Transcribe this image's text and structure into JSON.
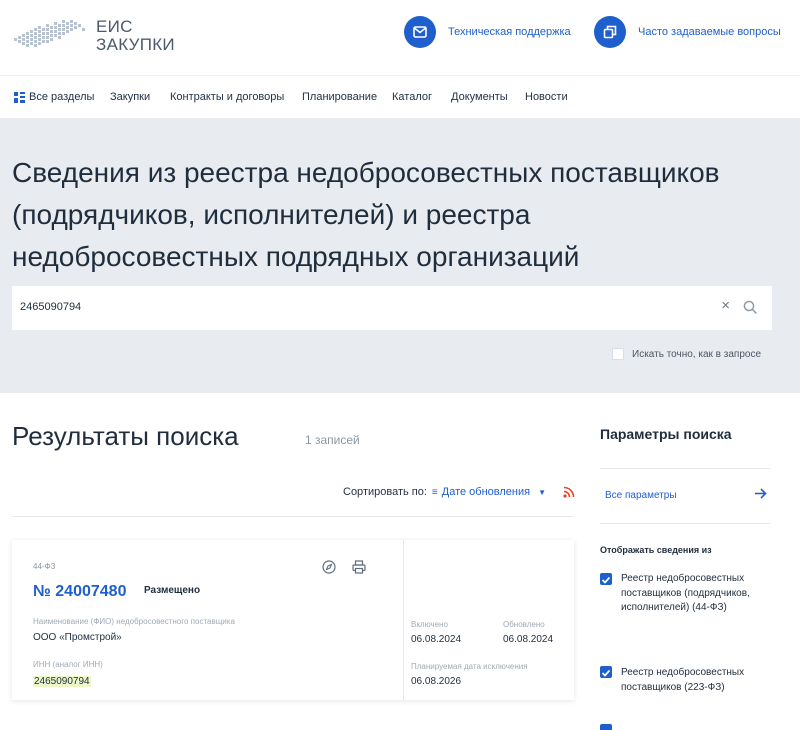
{
  "header": {
    "logo": {
      "line1": "ЕИС",
      "line2": "ЗАКУПКИ"
    },
    "support_label": "Техническая поддержка",
    "faq_label": "Часто задаваемые вопросы"
  },
  "nav": {
    "items": [
      "Все разделы",
      "Закупки",
      "Контракты и договоры",
      "Планирование",
      "Каталог",
      "Документы",
      "Новости"
    ]
  },
  "hero": {
    "title": "Сведения из реестра недобросовестных поставщиков (подрядчиков, исполнителей) и реестра недобросовестных подрядных организаций",
    "search_value": "2465090794",
    "clear_symbol": "×",
    "exact_match_label": "Искать точно, как в запросе"
  },
  "results": {
    "title": "Результаты поиска",
    "count": "1 записей",
    "sort_prefix": "Сортировать по:",
    "sort_value": "Дате обновления"
  },
  "card": {
    "law": "44-ФЗ",
    "number": "№ 24007480",
    "status": "Размещено",
    "supplier_label": "Наименование (ФИО) недобросовестного поставщика",
    "supplier_name": "ООО «Промстрой»",
    "inn_label": "ИНН (аналог ИНН)",
    "inn_value": "2465090794",
    "included_label": "Включено",
    "included_date": "06.08.2024",
    "updated_label": "Обновлено",
    "updated_date": "06.08.2024",
    "planned_label": "Планируемая дата исключения",
    "planned_date": "06.08.2026"
  },
  "sidebar": {
    "title": "Параметры поиска",
    "all_params": "Все параметры",
    "show_from_label": "Отображать сведения из",
    "registries": [
      {
        "label": "Реестр недобросовестных поставщиков (подрядчиков, исполнителей) (44-ФЗ)",
        "checked": true
      },
      {
        "label": "Реестр недобросовестных поставщиков (223-ФЗ)",
        "checked": true
      }
    ]
  },
  "colors": {
    "accent": "#1f5fcd",
    "hero_bg": "#e8ecf1",
    "rss": "#e8421f",
    "highlight": "#eef7c8"
  },
  "icons": [
    "russia-map-logo-icon",
    "mail-icon",
    "copy-icon",
    "grid-icon",
    "search-icon",
    "close-icon",
    "filter-icon",
    "chevron-down-icon",
    "rss-icon",
    "compass-icon",
    "print-icon",
    "arrow-right-icon",
    "checkbox-checked-icon"
  ]
}
